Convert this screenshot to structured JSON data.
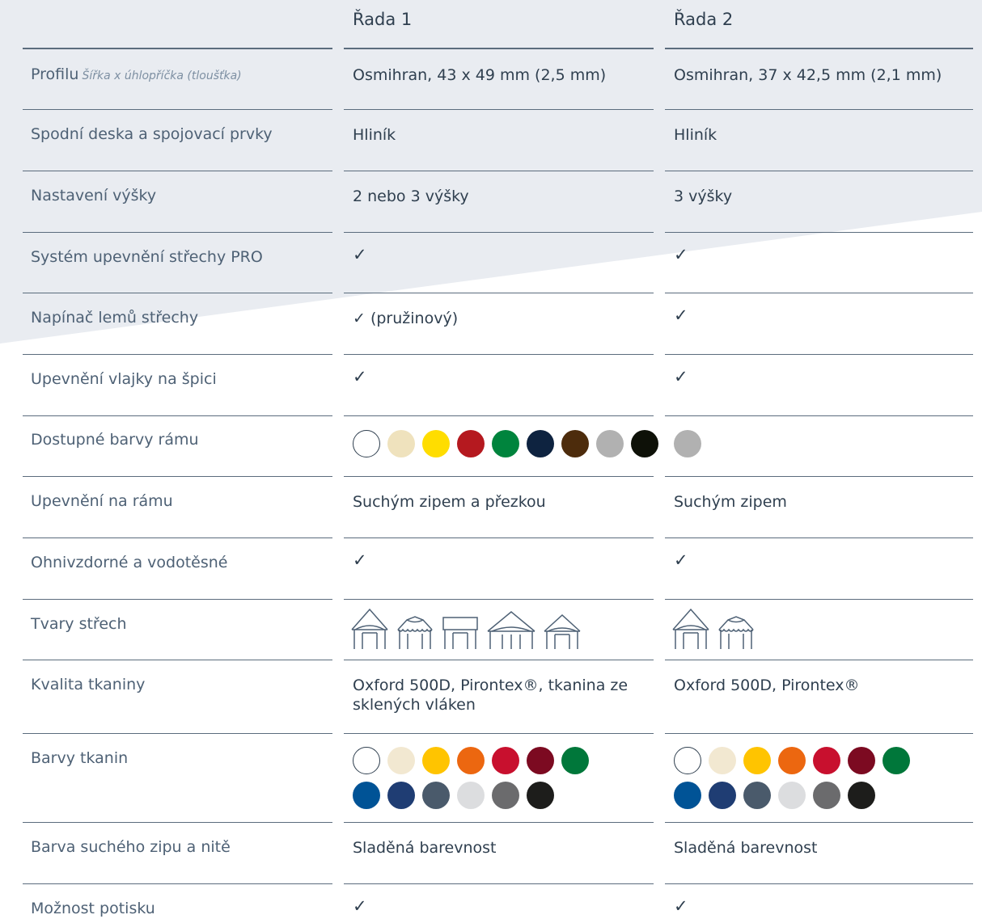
{
  "columns": [
    "Řada 1",
    "Řada 2"
  ],
  "rows": [
    {
      "label": "Profilu",
      "label_sub": "Šířka x úhlopříčka (tloušťka)",
      "c1": "Osmihran, 43 x 49 mm (2,5 mm)",
      "c2": "Osmihran, 37 x 42,5 mm (2,1 mm)"
    },
    {
      "label": "Spodní deska a spojovací prvky",
      "c1": "Hliník",
      "c2": "Hliník"
    },
    {
      "label": "Nastavení výšky",
      "c1": "2 nebo 3 výšky",
      "c2": "3 výšky"
    },
    {
      "label": "Systém upevnění střechy PRO",
      "c1": "✓",
      "c2": "✓"
    },
    {
      "label": "Napínač lemů střechy",
      "c1": "✓ (pružinový)",
      "c2": "✓"
    },
    {
      "label": "Upevnění vlajky na špici",
      "c1": "✓",
      "c2": "✓"
    },
    {
      "label": "Dostupné barvy rámu"
    },
    {
      "label": "Upevnění na rámu",
      "c1": "Suchým zipem a přezkou",
      "c2": "Suchým zipem"
    },
    {
      "label": "Ohnivzdorné a vodotěsné",
      "c1": "✓",
      "c2": "✓"
    },
    {
      "label": "Tvary střech"
    },
    {
      "label": "Kvalita tkaniny",
      "c1": "Oxford 500D, Pirontex®, tkanina ze sklených vláken",
      "c2": "Oxford 500D, Pirontex®"
    },
    {
      "label": "Barvy tkanin"
    },
    {
      "label": "Barva suchého zipu a nitě",
      "c1": "Sladěná barevnost",
      "c2": "Sladěná barevnost"
    },
    {
      "label": "Možnost potisku",
      "c1": "✓",
      "c2": "✓"
    }
  ],
  "frame_colors": {
    "c1": [
      "#ffffff",
      "#efe2bd",
      "#ffdd00",
      "#b5191f",
      "#00843d",
      "#0e2340",
      "#4d2c0c",
      "#b1b1b1",
      "#0e1108"
    ],
    "c2": [
      "#b1b1b1"
    ]
  },
  "roof_shapes": {
    "c1": [
      "pagoda-roof-icon",
      "scalloped-roof-icon",
      "flat-roof-icon",
      "wide-pagoda-roof-icon",
      "small-pagoda-roof-icon"
    ],
    "c2": [
      "pagoda-roof-icon",
      "scalloped-roof-icon"
    ]
  },
  "fabric_colors": {
    "c1": [
      "#ffffff",
      "#f2e8d1",
      "#ffc400",
      "#ec6710",
      "#c8102e",
      "#7c0a21",
      "#00773a",
      "#005396",
      "#1f3d73",
      "#4a5a6b",
      "#dcdddf",
      "#6b6b6d",
      "#1d1d1b"
    ],
    "c2": [
      "#ffffff",
      "#f2e8d1",
      "#ffc400",
      "#ec6710",
      "#c8102e",
      "#7c0a21",
      "#00773a",
      "#005396",
      "#1f3d73",
      "#4a5a6b",
      "#dcdddf",
      "#6b6b6d",
      "#1d1d1b"
    ]
  },
  "colors": {
    "band": "#e9ecf1",
    "rule": "#5b6c7d",
    "label": "#4e6175"
  }
}
